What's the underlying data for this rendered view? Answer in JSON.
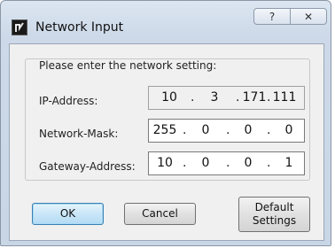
{
  "window": {
    "title": "Network Input",
    "help_glyph": "?",
    "close_glyph": "✕",
    "app_icon": "app-logo-icon"
  },
  "group": {
    "legend": "Please enter the network setting:"
  },
  "rows": [
    {
      "label": "IP-Address:",
      "readonly": true,
      "octets": [
        "10",
        "3",
        "171",
        "111"
      ]
    },
    {
      "label": "Network-Mask:",
      "readonly": false,
      "octets": [
        "255",
        "0",
        "0",
        "0"
      ]
    },
    {
      "label": "Gateway-Address:",
      "readonly": false,
      "octets": [
        "10",
        "0",
        "0",
        "1"
      ]
    }
  ],
  "dot": ".",
  "buttons": {
    "ok": "OK",
    "cancel": "Cancel",
    "default_line1": "Default",
    "default_line2": "Settings"
  }
}
